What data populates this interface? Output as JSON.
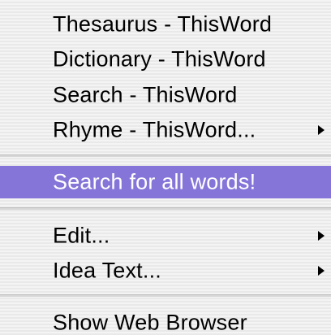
{
  "menu": {
    "items": [
      {
        "label": "Thesaurus - ThisWord",
        "has_submenu": false
      },
      {
        "label": "Dictionary - ThisWord",
        "has_submenu": false
      },
      {
        "label": "Search - ThisWord",
        "has_submenu": false
      },
      {
        "label": "Rhyme - ThisWord...",
        "has_submenu": true
      },
      {
        "label": "Search for all words!",
        "has_submenu": false,
        "highlighted": true
      },
      {
        "label": "Edit...",
        "has_submenu": true
      },
      {
        "label": "Idea Text...",
        "has_submenu": true
      },
      {
        "label": "Show Web Browser",
        "has_submenu": false
      }
    ],
    "submenu_icon": "triangle-right-icon",
    "highlight_color": "#8675d8"
  }
}
